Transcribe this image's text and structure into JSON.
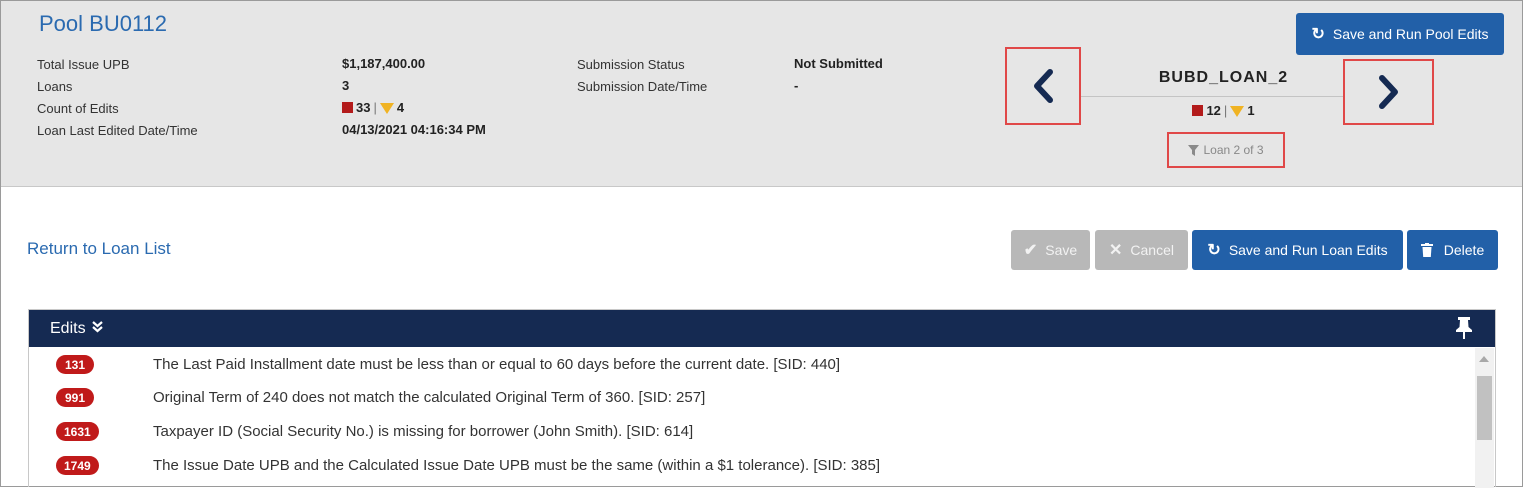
{
  "pool": {
    "title": "Pool BU0112",
    "info_left": [
      {
        "label": "Total Issue UPB",
        "value": "$1,187,400.00"
      },
      {
        "label": "Loans",
        "value": "3"
      },
      {
        "label": "Count of Edits",
        "errors": "33",
        "warnings": "4"
      },
      {
        "label": "Loan Last Edited Date/Time",
        "value": "04/13/2021 04:16:34 PM"
      }
    ],
    "info_right": [
      {
        "label": "Submission Status",
        "value": "Not Submitted"
      },
      {
        "label": "Submission Date/Time",
        "value": "-"
      }
    ],
    "save_run_pool_label": "Save and Run Pool Edits"
  },
  "loan_nav": {
    "loan_name": "BUBD_LOAN_2",
    "errors": "12",
    "warnings": "1",
    "position": "Loan 2 of 3",
    "separator": "|"
  },
  "toolbar": {
    "return_label": "Return to Loan List",
    "save_label": "Save",
    "cancel_label": "Cancel",
    "save_run_loan_label": "Save and Run Loan Edits",
    "delete_label": "Delete"
  },
  "edits": {
    "title": "Edits",
    "rows": [
      {
        "code": "131",
        "message": "The Last Paid Installment date must be less than or equal to 60 days before the current date. [SID: 440]"
      },
      {
        "code": "991",
        "message": "Original Term of 240 does not match the calculated Original Term of 360. [SID: 257]"
      },
      {
        "code": "1631",
        "message": "Taxpayer ID (Social Security No.) is missing for borrower (John Smith). [SID: 614]"
      },
      {
        "code": "1749",
        "message": "The Issue Date UPB and the Calculated Issue Date UPB must be the same (within a $1 tolerance). [SID: 385]"
      }
    ]
  },
  "colors": {
    "primary": "#2260a8",
    "header_bg": "#e6e6e6",
    "panel_head": "#152a52",
    "error": "#c01a1a",
    "warning": "#f0b323",
    "link": "#2a6ab0"
  }
}
